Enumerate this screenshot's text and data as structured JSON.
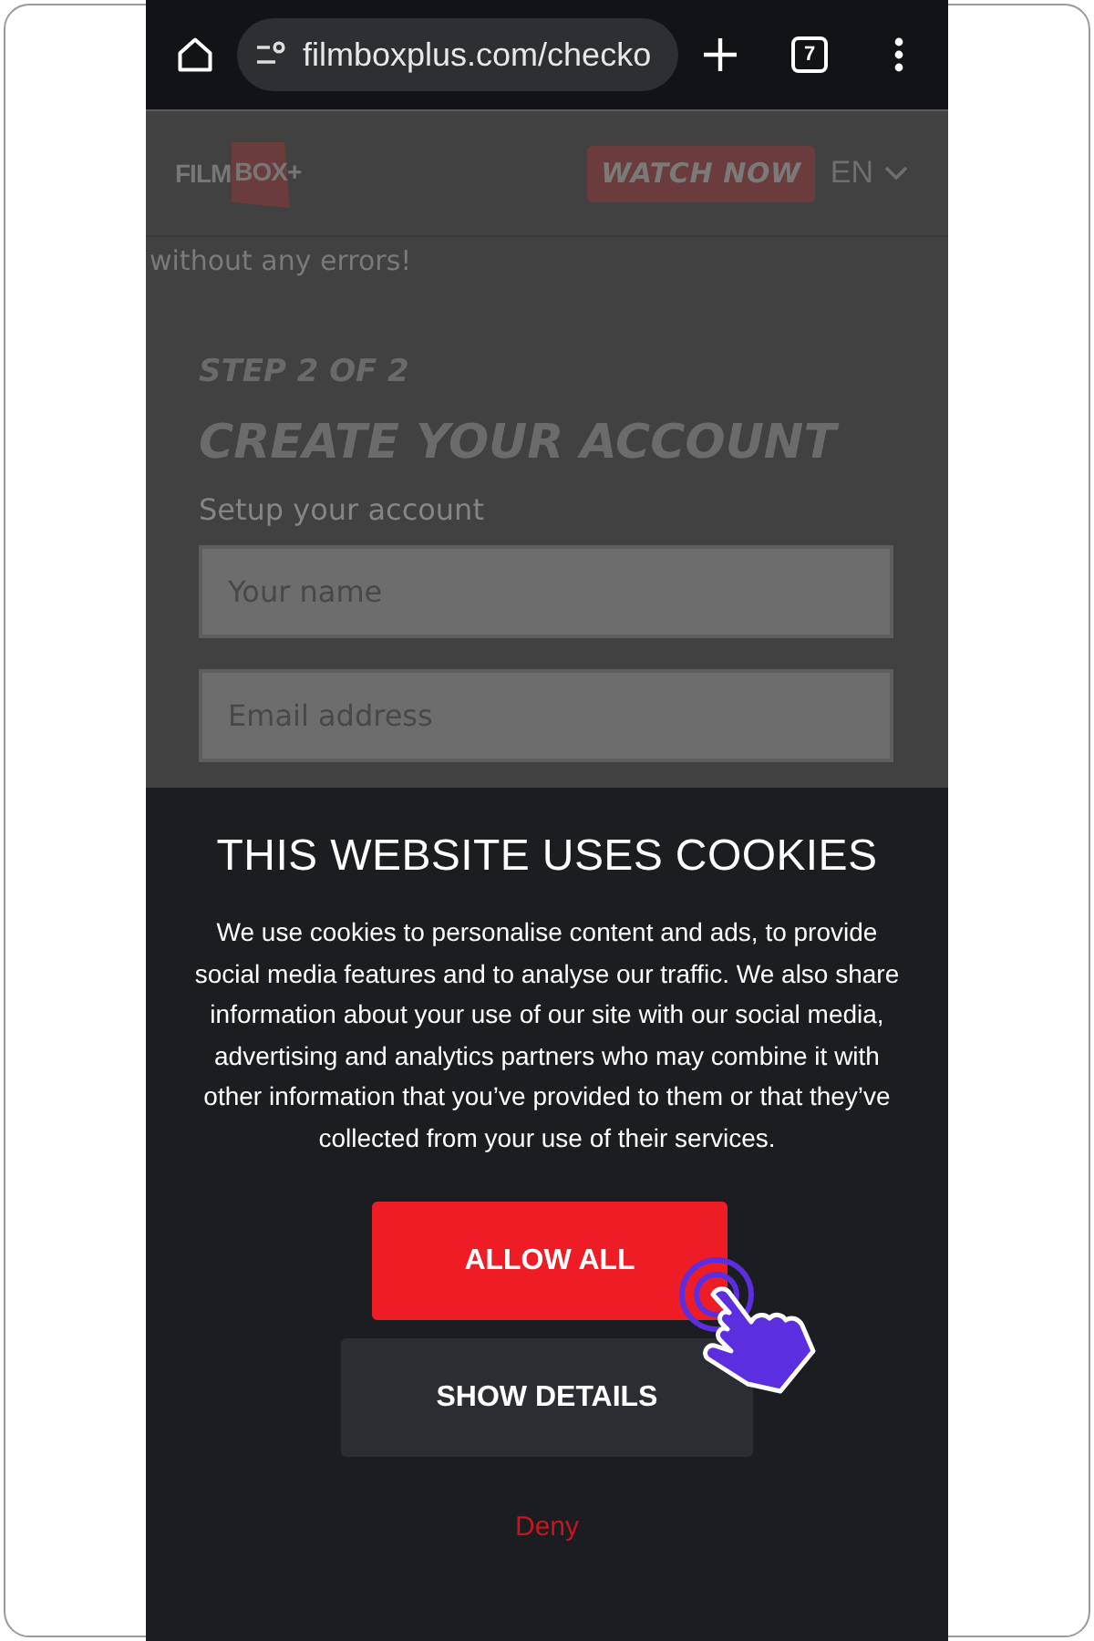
{
  "browser": {
    "url": "filmboxplus.com/checko",
    "tab_count": "7"
  },
  "header": {
    "logo": [
      "FILM",
      "BOX+"
    ],
    "watch_button": "WATCH NOW",
    "language": "EN"
  },
  "notice": "without any errors!",
  "form": {
    "step": "STEP 2 OF 2",
    "title": "CREATE YOUR ACCOUNT",
    "subtitle": "Setup your account",
    "fields": [
      {
        "placeholder": "Your name"
      },
      {
        "placeholder": "Email address"
      }
    ]
  },
  "cookie_banner": {
    "title": "THIS WEBSITE USES COOKIES",
    "text": "We use cookies to personalise content and ads, to provide social media features and to analyse our traffic. We also share information about your use of our site with our social media, advertising and analytics partners who may combine it with other information that you’ve provided to them or that they’ve collected from your use of their services.",
    "buttons": [
      {
        "label": "ALLOW ALL",
        "kind": "primary"
      },
      {
        "label": "SHOW DETAILS",
        "kind": "secondary"
      },
      {
        "label": "Deny",
        "kind": "link"
      }
    ]
  }
}
